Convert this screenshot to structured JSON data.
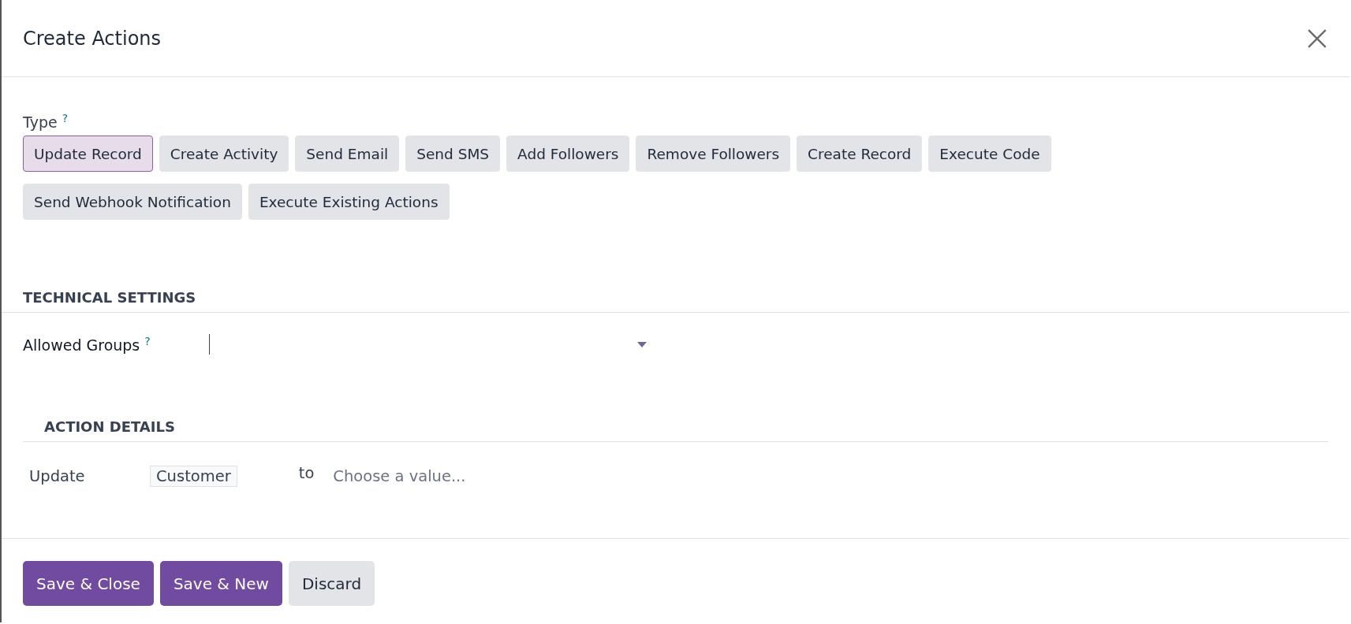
{
  "dialog": {
    "title": "Create Actions"
  },
  "type_field": {
    "label": "Type",
    "help_mark": "?",
    "options": [
      {
        "label": "Update Record",
        "selected": true
      },
      {
        "label": "Create Activity",
        "selected": false
      },
      {
        "label": "Send Email",
        "selected": false
      },
      {
        "label": "Send SMS",
        "selected": false
      },
      {
        "label": "Add Followers",
        "selected": false
      },
      {
        "label": "Remove Followers",
        "selected": false
      },
      {
        "label": "Create Record",
        "selected": false
      },
      {
        "label": "Execute Code",
        "selected": false
      },
      {
        "label": "Send Webhook Notification",
        "selected": false
      },
      {
        "label": "Execute Existing Actions",
        "selected": false
      }
    ]
  },
  "technical_settings": {
    "heading": "TECHNICAL SETTINGS",
    "allowed_groups": {
      "label": "Allowed Groups",
      "help_mark": "?"
    }
  },
  "action_details": {
    "heading": "ACTION DETAILS",
    "update_label": "Update",
    "field_tag": "Customer",
    "to_label": "to",
    "value": {
      "placeholder": "Choose a value..."
    }
  },
  "footer_buttons": [
    {
      "label": "Save & Close",
      "kind": "primary"
    },
    {
      "label": "Save & New",
      "kind": "primary"
    },
    {
      "label": "Discard",
      "kind": "secondary"
    }
  ]
}
